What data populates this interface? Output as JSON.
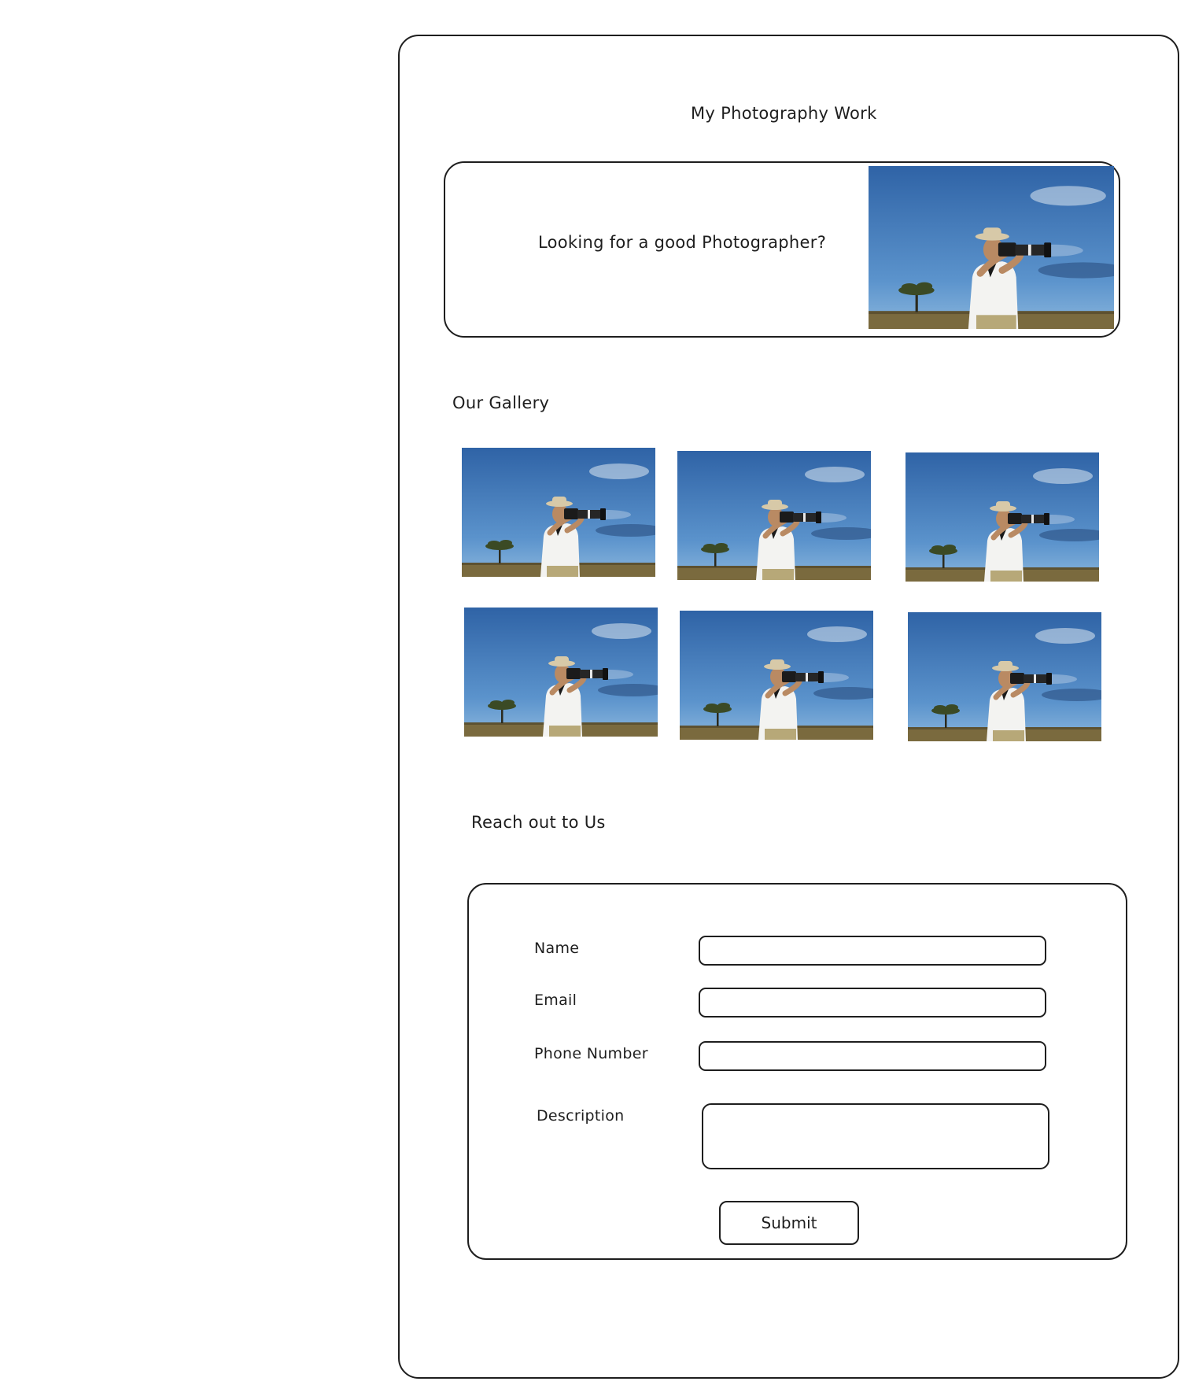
{
  "page": {
    "title": "My Photography Work"
  },
  "hero": {
    "tagline": "Looking for a good Photographer?",
    "image_alt": "photographer-image"
  },
  "gallery": {
    "heading": "Our Gallery",
    "image_count": 6
  },
  "contact": {
    "heading": "Reach out to Us",
    "fields": {
      "name": {
        "label": "Name",
        "value": "",
        "placeholder": ""
      },
      "email": {
        "label": "Email",
        "value": "",
        "placeholder": ""
      },
      "phone": {
        "label": "Phone Number",
        "value": "",
        "placeholder": ""
      },
      "description": {
        "label": "Description",
        "value": "",
        "placeholder": ""
      }
    },
    "submit_label": "Submit"
  },
  "colors": {
    "stroke": "#1e1e1e",
    "background": "#ffffff",
    "sky": "#3f78b8",
    "ground": "#7a6a3e"
  }
}
